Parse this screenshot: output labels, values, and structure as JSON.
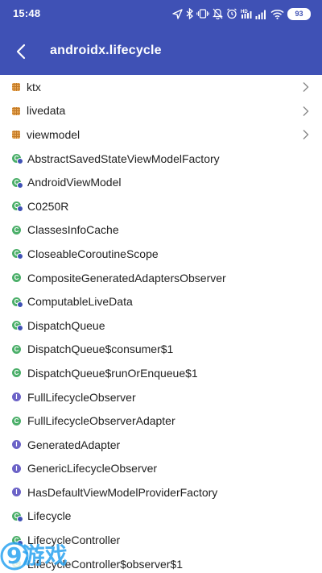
{
  "status_bar": {
    "time": "15:48",
    "battery": "93",
    "icons": [
      "location-icon",
      "bluetooth-icon",
      "vibrate-icon",
      "dnd-icon",
      "alarm-icon",
      "hd-icon",
      "signal-icon",
      "wifi-icon",
      "battery-icon"
    ]
  },
  "app_bar": {
    "title": "androidx.lifecycle",
    "back_icon": "back-arrow-icon",
    "color": "#3f51b5"
  },
  "list": {
    "items": [
      {
        "label": "ktx",
        "kind": "package",
        "chevron": true
      },
      {
        "label": "livedata",
        "kind": "package",
        "chevron": true
      },
      {
        "label": "viewmodel",
        "kind": "package",
        "chevron": true
      },
      {
        "label": "AbstractSavedStateViewModelFactory",
        "kind": "abstract"
      },
      {
        "label": "AndroidViewModel",
        "kind": "abstract"
      },
      {
        "label": "C0250R",
        "kind": "abstract"
      },
      {
        "label": "ClassesInfoCache",
        "kind": "class"
      },
      {
        "label": "CloseableCoroutineScope",
        "kind": "abstract"
      },
      {
        "label": "CompositeGeneratedAdaptersObserver",
        "kind": "class"
      },
      {
        "label": "ComputableLiveData",
        "kind": "abstract"
      },
      {
        "label": "DispatchQueue",
        "kind": "abstract"
      },
      {
        "label": "DispatchQueue$consumer$1",
        "kind": "class"
      },
      {
        "label": "DispatchQueue$runOrEnqueue$1",
        "kind": "class"
      },
      {
        "label": "FullLifecycleObserver",
        "kind": "interface"
      },
      {
        "label": "FullLifecycleObserverAdapter",
        "kind": "class"
      },
      {
        "label": "GeneratedAdapter",
        "kind": "interface"
      },
      {
        "label": "GenericLifecycleObserver",
        "kind": "interface"
      },
      {
        "label": "HasDefaultViewModelProviderFactory",
        "kind": "interface"
      },
      {
        "label": "Lifecycle",
        "kind": "abstract"
      },
      {
        "label": "LifecycleController",
        "kind": "abstract"
      },
      {
        "label": "LifecycleController$observer$1",
        "kind": "class"
      }
    ]
  },
  "watermark": {
    "text": "9游戏",
    "color": "#2aa3f0"
  },
  "colors": {
    "package_icon": "#e8a85a",
    "class_icon": "#4caf6a",
    "interface_icon": "#6c63c7",
    "text": "#222222",
    "chevron": "#888888"
  }
}
